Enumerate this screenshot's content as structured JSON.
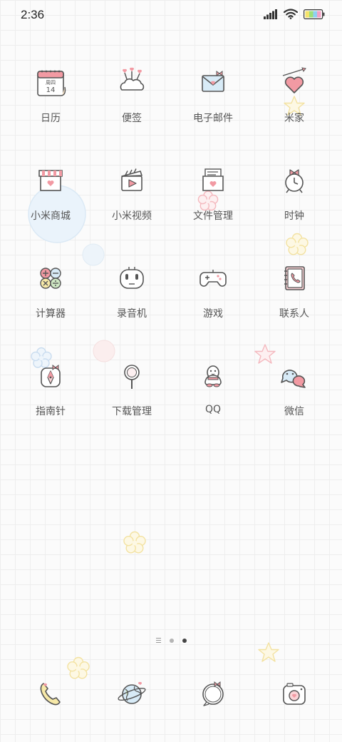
{
  "status_bar": {
    "time": "2:36",
    "icons": [
      "signal-icon",
      "wifi-icon",
      "battery-icon"
    ]
  },
  "apps": [
    {
      "label": "日历",
      "icon": "calendar-icon",
      "calendar_weekday": "周四",
      "calendar_day": "14"
    },
    {
      "label": "便签",
      "icon": "notes-icon"
    },
    {
      "label": "电子邮件",
      "icon": "email-icon"
    },
    {
      "label": "米家",
      "icon": "mijia-icon"
    },
    {
      "label": "小米商城",
      "icon": "shop-icon"
    },
    {
      "label": "小米视频",
      "icon": "video-icon"
    },
    {
      "label": "文件管理",
      "icon": "file-manager-icon"
    },
    {
      "label": "时钟",
      "icon": "clock-icon"
    },
    {
      "label": "计算器",
      "icon": "calculator-icon"
    },
    {
      "label": "录音机",
      "icon": "recorder-icon"
    },
    {
      "label": "游戏",
      "icon": "gamepad-icon"
    },
    {
      "label": "联系人",
      "icon": "contacts-icon"
    },
    {
      "label": "指南针",
      "icon": "compass-icon"
    },
    {
      "label": "下载管理",
      "icon": "download-icon"
    },
    {
      "label": "QQ",
      "icon": "qq-icon"
    },
    {
      "label": "微信",
      "icon": "wechat-icon"
    }
  ],
  "page_indicator": {
    "pages": 3,
    "active_index": 2
  },
  "dock": [
    {
      "icon": "phone-icon"
    },
    {
      "icon": "browser-icon"
    },
    {
      "icon": "messages-icon"
    },
    {
      "icon": "camera-icon"
    }
  ],
  "colors": {
    "stroke": "#555555",
    "pink": "#f29aa3",
    "light_pink": "#fbd3d6",
    "yellow": "#f7e9a8",
    "blue": "#cfe3f2",
    "green": "#cfe8c4"
  }
}
